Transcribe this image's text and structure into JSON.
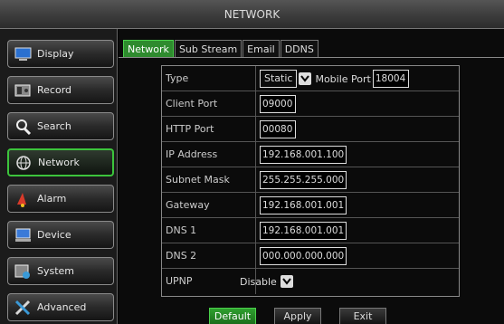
{
  "window": {
    "title": "NETWORK"
  },
  "sidebar": {
    "items": [
      {
        "label": "Display",
        "icon": "monitor-icon"
      },
      {
        "label": "Record",
        "icon": "record-icon"
      },
      {
        "label": "Search",
        "icon": "search-icon"
      },
      {
        "label": "Network",
        "icon": "network-icon",
        "active": true
      },
      {
        "label": "Alarm",
        "icon": "alarm-icon"
      },
      {
        "label": "Device",
        "icon": "device-icon"
      },
      {
        "label": "System",
        "icon": "system-icon"
      },
      {
        "label": "Advanced",
        "icon": "advanced-icon"
      }
    ]
  },
  "tabs": [
    {
      "label": "Network",
      "active": true
    },
    {
      "label": "Sub Stream"
    },
    {
      "label": "Email"
    },
    {
      "label": "DDNS"
    }
  ],
  "form": {
    "type": {
      "label": "Type",
      "value": "Static",
      "mobile_port_label": "Mobile Port",
      "mobile_port": "18004"
    },
    "client_port": {
      "label": "Client Port",
      "value": "09000"
    },
    "http_port": {
      "label": "HTTP Port",
      "value": "00080"
    },
    "ip_address": {
      "label": "IP Address",
      "value": "192.168.001.100"
    },
    "subnet_mask": {
      "label": "Subnet Mask",
      "value": "255.255.255.000"
    },
    "gateway": {
      "label": "Gateway",
      "value": "192.168.001.001"
    },
    "dns1": {
      "label": "DNS 1",
      "value": "192.168.001.001"
    },
    "dns2": {
      "label": "DNS 2",
      "value": "000.000.000.000"
    },
    "upnp": {
      "label": "UPNP",
      "value": "Disable"
    }
  },
  "buttons": {
    "default": "Default",
    "apply": "Apply",
    "exit": "Exit"
  },
  "colors": {
    "accent_green": "#2e8b2e",
    "active_border": "#3cc43c"
  }
}
